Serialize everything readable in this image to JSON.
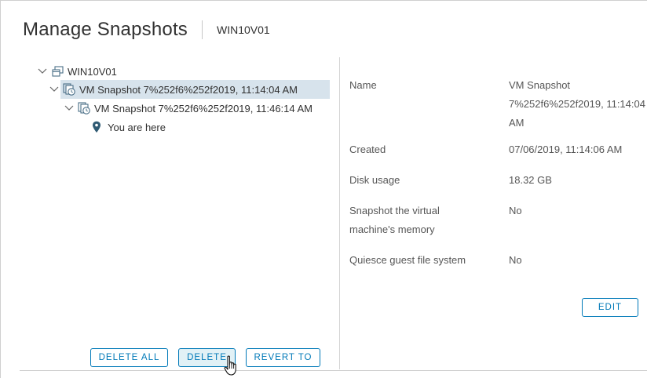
{
  "dialog": {
    "title": "Manage Snapshots",
    "subtitle": "WIN10V01"
  },
  "tree": {
    "root": {
      "label": "WIN10V01",
      "icon": "vm-icon",
      "expanded": true
    },
    "snapshot1": {
      "label": "VM Snapshot 7%252f6%252f2019, 11:14:04 AM",
      "icon": "snapshot-icon",
      "expanded": true,
      "selected": true
    },
    "snapshot2": {
      "label": "VM Snapshot 7%252f6%252f2019, 11:46:14 AM",
      "icon": "snapshot-icon",
      "expanded": true
    },
    "current": {
      "label": "You are here",
      "icon": "location-pin-icon"
    }
  },
  "details": {
    "name_label": "Name",
    "name_value": "VM Snapshot 7%252f6%252f2019, 11:14:04 AM",
    "created_label": "Created",
    "created_value": "07/06/2019, 11:14:06 AM",
    "disk_label": "Disk usage",
    "disk_value": "18.32 GB",
    "memory_label": "Snapshot the virtual machine's memory",
    "memory_value": "No",
    "quiesce_label": "Quiesce guest file system",
    "quiesce_value": "No"
  },
  "buttons": {
    "edit": "EDIT",
    "delete_all": "DELETE ALL",
    "delete": "DELETE",
    "revert_to": "REVERT TO"
  },
  "colors": {
    "accent": "#0079b8",
    "selected_row": "#d7e3ec",
    "button_hover": "#e1f1f6",
    "pin": "#2f5a73"
  }
}
